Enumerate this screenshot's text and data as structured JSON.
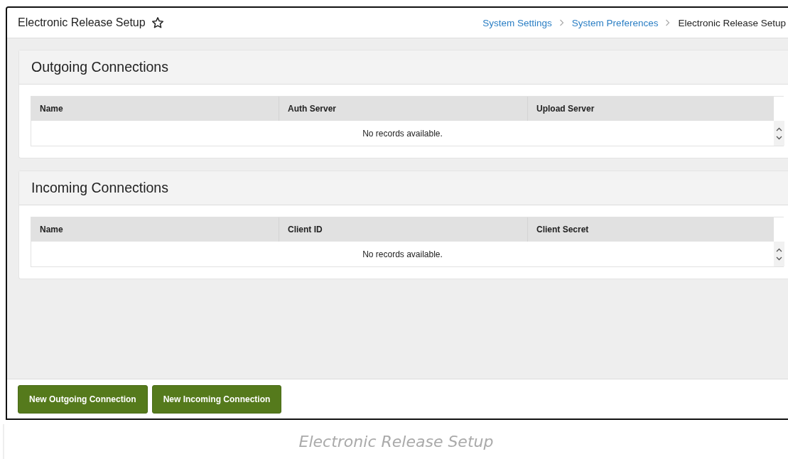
{
  "page": {
    "title": "Electronic Release Setup",
    "favorite": false
  },
  "breadcrumb": [
    {
      "label": "System Settings",
      "kind": "link"
    },
    {
      "label": "System Preferences",
      "kind": "link"
    },
    {
      "label": "Electronic Release Setup",
      "kind": "current"
    }
  ],
  "sections": [
    {
      "title": "Outgoing Connections",
      "columns": [
        "Name",
        "Auth Server",
        "Upload Server"
      ],
      "empty_message": "No records available."
    },
    {
      "title": "Incoming Connections",
      "columns": [
        "Name",
        "Client ID",
        "Client Secret"
      ],
      "empty_message": "No records available."
    }
  ],
  "buttons": [
    "New Outgoing Connection",
    "New Incoming Connection"
  ],
  "caption": "Electronic Release Setup"
}
